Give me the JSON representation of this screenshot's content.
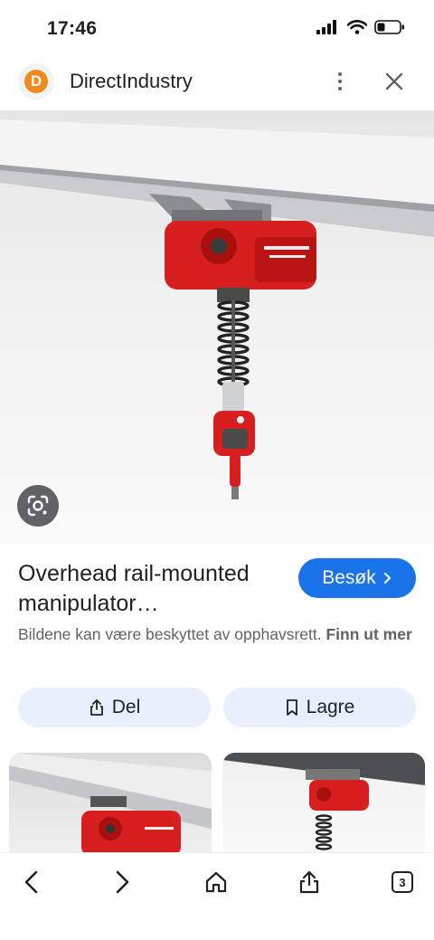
{
  "status_bar": {
    "time": "17:46"
  },
  "header": {
    "logo_letter": "D",
    "site_name": "DirectIndustry",
    "icons": [
      "more-vert-icon",
      "close-icon"
    ]
  },
  "hero": {
    "icons": [
      "google-lens-icon"
    ]
  },
  "result": {
    "title": "Overhead rail-mounted manipulator…",
    "visit_label": "Besøk",
    "copyright_text": "Bildene kan være beskyttet av opphavsrett.",
    "learn_more": "Finn ut mer",
    "share_label": "Del",
    "save_label": "Lagre"
  },
  "bottom_bar": {
    "tab_count": "3",
    "icons": [
      "back-icon",
      "forward-icon",
      "home-icon",
      "share-icon",
      "tabs-icon"
    ]
  },
  "colors": {
    "accent": "#1a73e8",
    "chip_bg": "#e8f0fe",
    "product_red": "#d71f1f",
    "logo_orange": "#f08a1c"
  }
}
